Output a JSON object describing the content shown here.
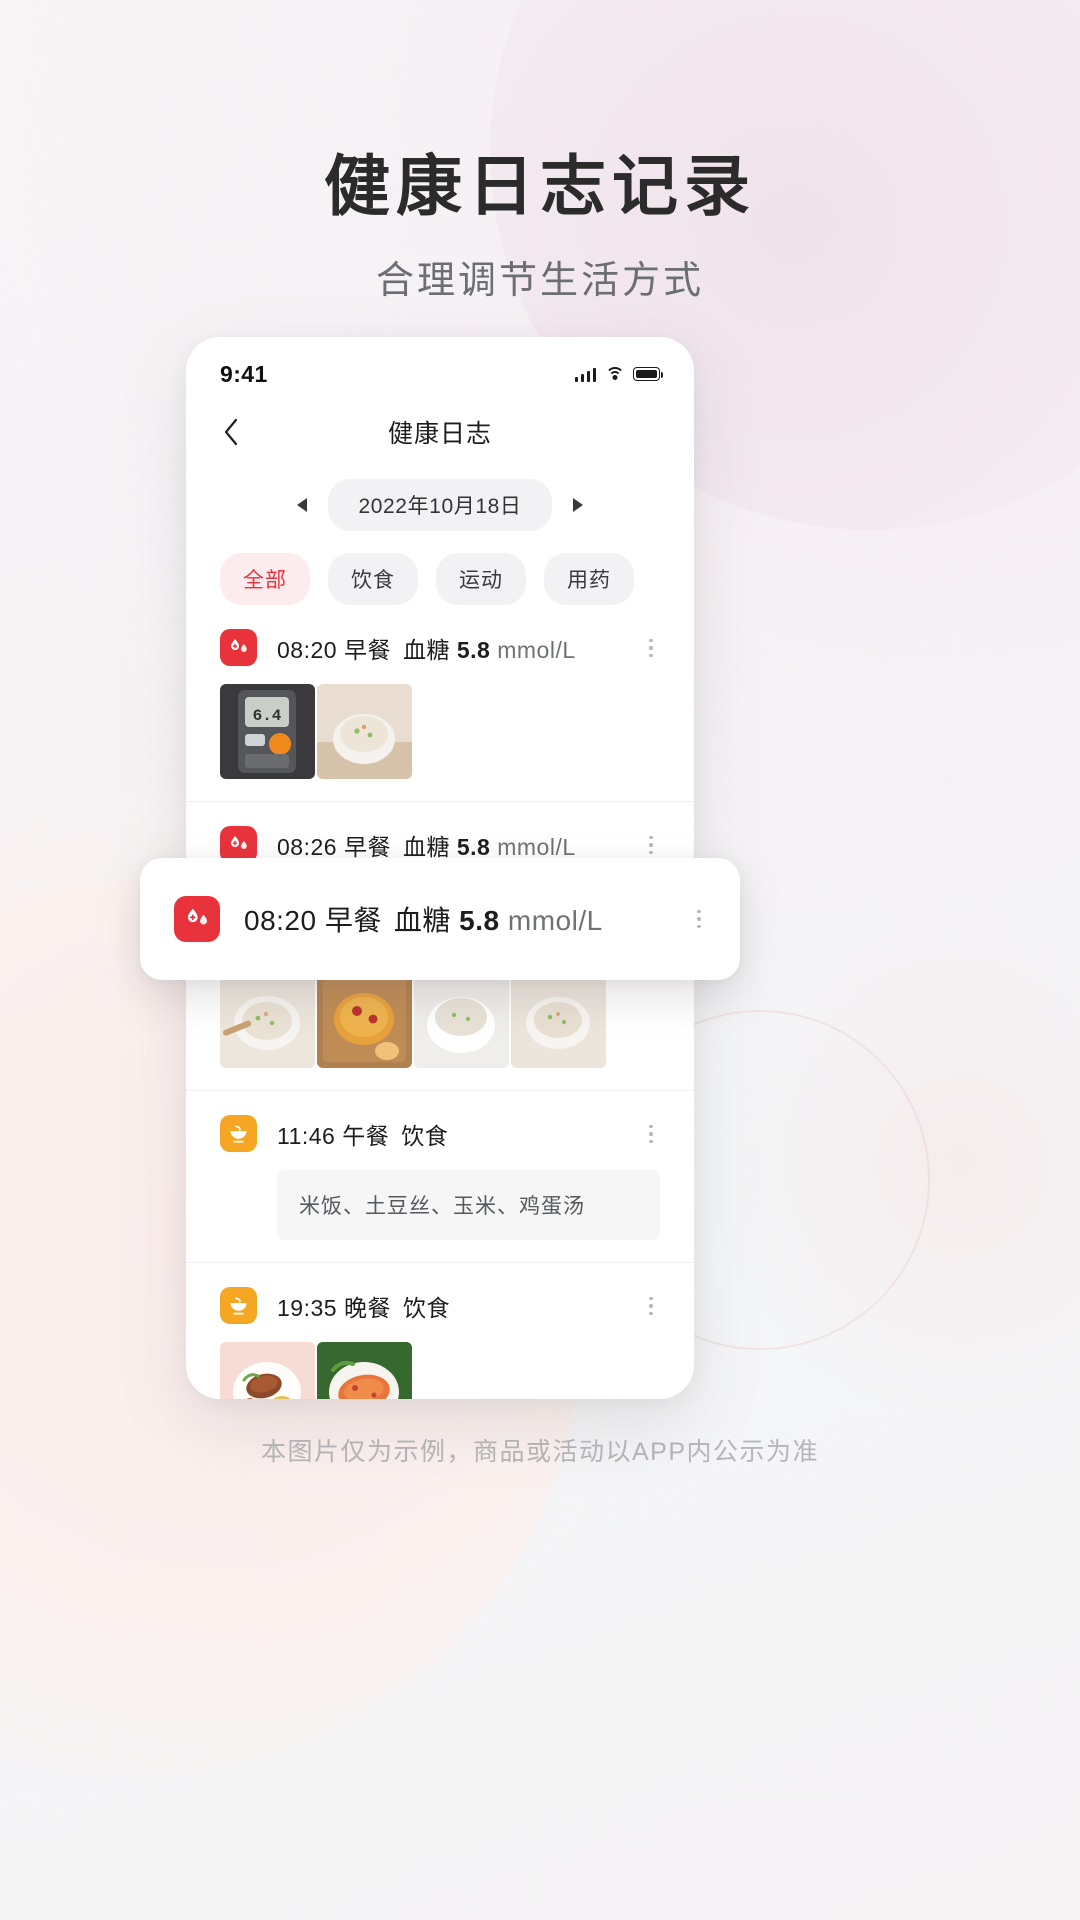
{
  "hero": {
    "title": "健康日志记录",
    "subtitle": "合理调节生活方式"
  },
  "phone": {
    "status": {
      "time": "9:41"
    },
    "nav": {
      "back_label": "‹",
      "title": "健康日志"
    },
    "date_selector": {
      "prev_label": "◀",
      "next_label": "▶",
      "value": "2022年10月18日"
    },
    "filters": [
      {
        "label": "全部",
        "active": true
      },
      {
        "label": "饮食",
        "active": false
      },
      {
        "label": "运动",
        "active": false
      },
      {
        "label": "用药",
        "active": false
      }
    ],
    "entries": [
      {
        "icon": "blood-drop-icon",
        "time": "08:20",
        "meal": "早餐",
        "metric_label": "血糖",
        "metric_value": "5.8",
        "metric_unit": "mmol/L",
        "menu_label": "⋮"
      },
      {
        "icon": "blood-drop-icon",
        "time": "08:26",
        "meal": "早餐",
        "metric_label": "血糖",
        "metric_value": "5.8",
        "metric_unit": "mmol/L",
        "menu_label": "⋮"
      },
      {
        "icon": "meal-bowl-icon",
        "time": "11:46",
        "meal": "午餐",
        "metric_label": "饮食",
        "metric_value": "",
        "metric_unit": "",
        "note": "米饭、土豆丝、玉米、鸡蛋汤",
        "menu_label": "⋮"
      },
      {
        "icon": "meal-bowl-icon",
        "time": "19:35",
        "meal": "晚餐",
        "metric_label": "饮食",
        "metric_value": "",
        "metric_unit": "",
        "menu_label": "⋮"
      }
    ],
    "float_card": {
      "icon": "blood-drop-icon",
      "time": "08:20",
      "meal": "早餐",
      "metric_label": "血糖",
      "metric_value": "5.8",
      "metric_unit": "mmol/L",
      "menu_label": "⋮"
    }
  },
  "footer": {
    "disclaimer": "本图片仅为示例，商品或活动以APP内公示为准"
  },
  "colors": {
    "accent_red": "#e8323c",
    "chip_active_bg": "#fdeced",
    "meal_orange": "#f5a623",
    "text_primary": "#1d1d1f",
    "text_muted": "#6e7175",
    "page_bg": "#f6f4f6"
  }
}
